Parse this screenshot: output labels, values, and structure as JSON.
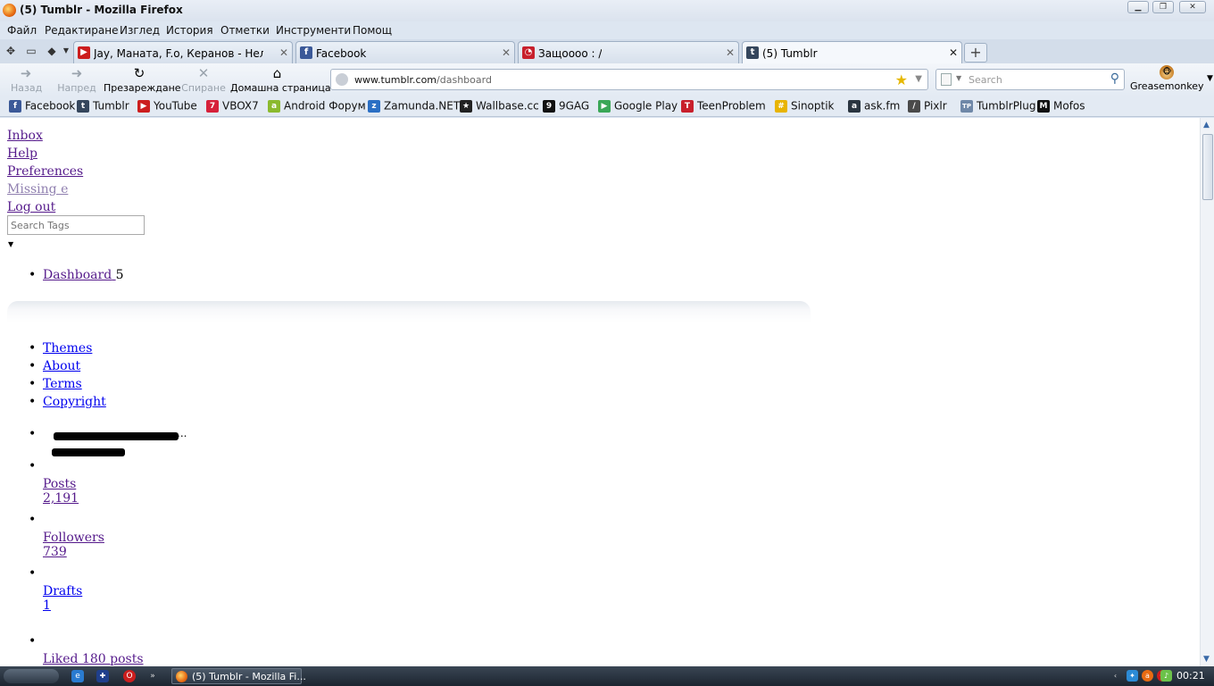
{
  "window": {
    "title": "(5) Tumblr - Mozilla Firefox"
  },
  "menu": [
    "Файл",
    "Редактиране",
    "Изглед",
    "История",
    "Отметки",
    "Инструменти",
    "Помощ"
  ],
  "tabs": [
    {
      "label": "Jay, Маната, F.o, Керанов - Неловко !...",
      "icon": "youtube-icon",
      "color": "#cc1e1e"
    },
    {
      "label": "Facebook",
      "icon": "facebook-icon",
      "color": "#3b5998"
    },
    {
      "label": "Защоооо : /",
      "icon": "teenproblem-icon",
      "color": "#c8202c"
    },
    {
      "label": "(5) Tumblr",
      "icon": "tumblr-icon",
      "color": "#35465c"
    }
  ],
  "nav": {
    "back": "Назад",
    "forward": "Напред",
    "reload": "Презареждане",
    "stop": "Спиране",
    "home": "Домашна страница",
    "url_domain": "www.tumblr.com",
    "url_path": "/dashboard",
    "search_placeholder": "Search",
    "greasemonkey": "Greasemonkey"
  },
  "bookmarks": [
    {
      "label": "Facebook",
      "icon": "facebook-icon",
      "color": "#3b5998",
      "glyph": "f"
    },
    {
      "label": "Tumblr",
      "icon": "tumblr-icon",
      "color": "#35465c",
      "glyph": "t"
    },
    {
      "label": "YouTube",
      "icon": "youtube-icon",
      "color": "#cc1e1e",
      "glyph": "▶"
    },
    {
      "label": "VBOX7",
      "icon": "vbox7-icon",
      "color": "#d6213a",
      "glyph": "7"
    },
    {
      "label": "Android Форум",
      "icon": "android-icon",
      "color": "#8bba2e",
      "glyph": "a"
    },
    {
      "label": "Zamunda.NET",
      "icon": "zamunda-icon",
      "color": "#2b6fc4",
      "glyph": "z"
    },
    {
      "label": "Wallbase.cc",
      "icon": "wallbase-icon",
      "color": "#222222",
      "glyph": "★"
    },
    {
      "label": "9GAG",
      "icon": "9gag-icon",
      "color": "#111111",
      "glyph": "9"
    },
    {
      "label": "Google Play",
      "icon": "google-play-icon",
      "color": "#3aa757",
      "glyph": "▶"
    },
    {
      "label": "TeenProblem",
      "icon": "teenproblem-icon",
      "color": "#c8202c",
      "glyph": "T"
    },
    {
      "label": "Sinoptik",
      "icon": "sinoptik-icon",
      "color": "#e8b400",
      "glyph": "#"
    },
    {
      "label": "ask.fm",
      "icon": "askfm-icon",
      "color": "#2a3540",
      "glyph": "a"
    },
    {
      "label": "Pixlr",
      "icon": "pixlr-icon",
      "color": "#4a4a4a",
      "glyph": "/"
    },
    {
      "label": "TumblrPlug",
      "icon": "tumblrplug-icon",
      "color": "#6f88a8",
      "glyph": "TP"
    },
    {
      "label": "Mofos",
      "icon": "mofos-icon",
      "color": "#111111",
      "glyph": "M"
    }
  ],
  "page": {
    "top_links": [
      "Inbox",
      "Help",
      "Preferences",
      "Missing e",
      "Log out"
    ],
    "search_tags_placeholder": "Search Tags",
    "dashboard_label": "Dashboard",
    "dashboard_count": "5",
    "footer_links": [
      "Themes",
      "About",
      "Terms",
      "Copyright"
    ],
    "stats": [
      {
        "label": "Posts",
        "value": "2,191"
      },
      {
        "label": "Followers",
        "value": "739"
      },
      {
        "label": "Drafts",
        "value": "1"
      }
    ],
    "liked": "Liked 180 posts"
  },
  "taskbar": {
    "task_label": "(5) Tumblr - Mozilla Fi...",
    "clock": "00:21"
  }
}
